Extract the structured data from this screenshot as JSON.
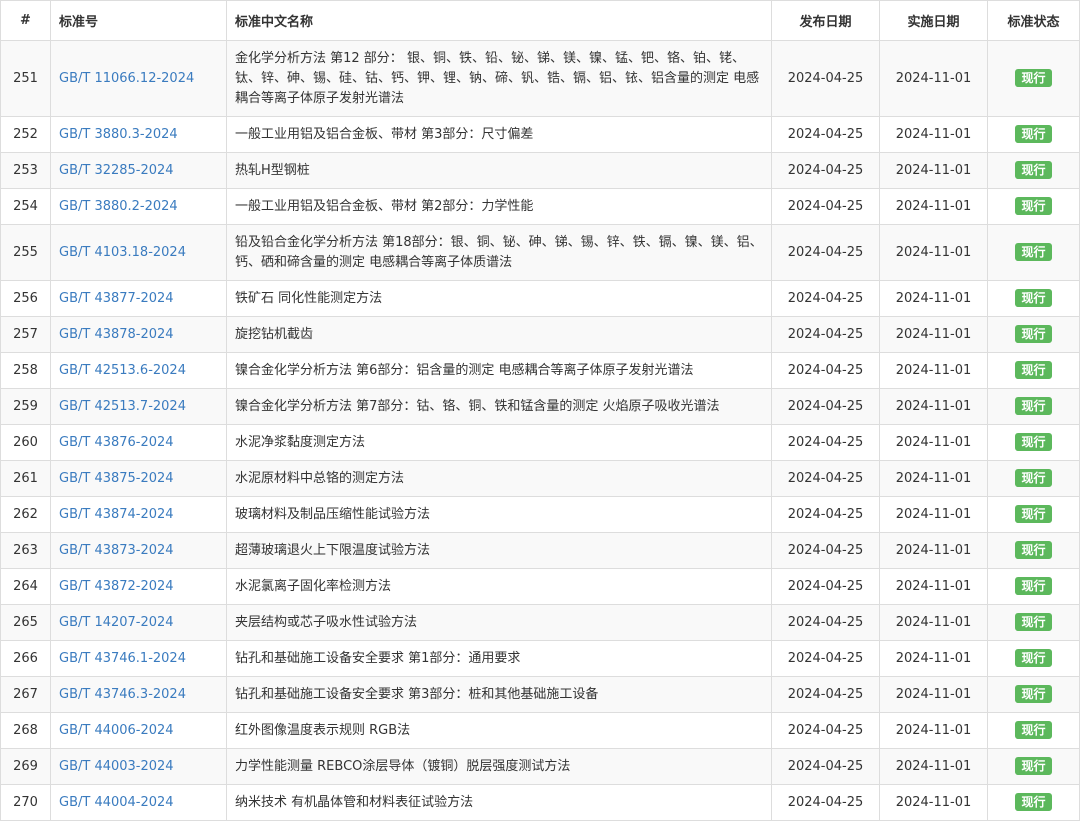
{
  "headers": {
    "num": "#",
    "code": "标准号",
    "name": "标准中文名称",
    "publish": "发布日期",
    "implement": "实施日期",
    "status": "标准状态"
  },
  "rows": [
    {
      "num": "251",
      "code": "GB/T 11066.12-2024",
      "name": "金化学分析方法 第12 部分： 银、铜、铁、铅、铋、锑、镁、镍、锰、钯、铬、铂、铑、钛、锌、砷、锡、硅、钴、钙、钾、锂、钠、碲、钒、锆、镉、铝、铱、铝含量的测定 电感耦合等离子体原子发射光谱法",
      "publish": "2024-04-25",
      "implement": "2024-11-01",
      "status": "现行"
    },
    {
      "num": "252",
      "code": "GB/T 3880.3-2024",
      "name": "一般工业用铝及铝合金板、带材 第3部分：尺寸偏差",
      "publish": "2024-04-25",
      "implement": "2024-11-01",
      "status": "现行"
    },
    {
      "num": "253",
      "code": "GB/T 32285-2024",
      "name": "热轧H型钢桩",
      "publish": "2024-04-25",
      "implement": "2024-11-01",
      "status": "现行"
    },
    {
      "num": "254",
      "code": "GB/T 3880.2-2024",
      "name": "一般工业用铝及铝合金板、带材 第2部分：力学性能",
      "publish": "2024-04-25",
      "implement": "2024-11-01",
      "status": "现行"
    },
    {
      "num": "255",
      "code": "GB/T 4103.18-2024",
      "name": "铅及铅合金化学分析方法 第18部分：银、铜、铋、砷、锑、锡、锌、铁、镉、镍、镁、铝、钙、硒和碲含量的测定 电感耦合等离子体质谱法",
      "publish": "2024-04-25",
      "implement": "2024-11-01",
      "status": "现行"
    },
    {
      "num": "256",
      "code": "GB/T 43877-2024",
      "name": "铁矿石 同化性能测定方法",
      "publish": "2024-04-25",
      "implement": "2024-11-01",
      "status": "现行"
    },
    {
      "num": "257",
      "code": "GB/T 43878-2024",
      "name": "旋挖钻机截齿",
      "publish": "2024-04-25",
      "implement": "2024-11-01",
      "status": "现行"
    },
    {
      "num": "258",
      "code": "GB/T 42513.6-2024",
      "name": "镍合金化学分析方法 第6部分：铝含量的测定 电感耦合等离子体原子发射光谱法",
      "publish": "2024-04-25",
      "implement": "2024-11-01",
      "status": "现行"
    },
    {
      "num": "259",
      "code": "GB/T 42513.7-2024",
      "name": "镍合金化学分析方法 第7部分：钴、铬、铜、铁和锰含量的测定 火焰原子吸收光谱法",
      "publish": "2024-04-25",
      "implement": "2024-11-01",
      "status": "现行"
    },
    {
      "num": "260",
      "code": "GB/T 43876-2024",
      "name": "水泥净浆黏度测定方法",
      "publish": "2024-04-25",
      "implement": "2024-11-01",
      "status": "现行"
    },
    {
      "num": "261",
      "code": "GB/T 43875-2024",
      "name": "水泥原材料中总铬的测定方法",
      "publish": "2024-04-25",
      "implement": "2024-11-01",
      "status": "现行"
    },
    {
      "num": "262",
      "code": "GB/T 43874-2024",
      "name": "玻璃材料及制品压缩性能试验方法",
      "publish": "2024-04-25",
      "implement": "2024-11-01",
      "status": "现行"
    },
    {
      "num": "263",
      "code": "GB/T 43873-2024",
      "name": "超薄玻璃退火上下限温度试验方法",
      "publish": "2024-04-25",
      "implement": "2024-11-01",
      "status": "现行"
    },
    {
      "num": "264",
      "code": "GB/T 43872-2024",
      "name": "水泥氯离子固化率检测方法",
      "publish": "2024-04-25",
      "implement": "2024-11-01",
      "status": "现行"
    },
    {
      "num": "265",
      "code": "GB/T 14207-2024",
      "name": "夹层结构或芯子吸水性试验方法",
      "publish": "2024-04-25",
      "implement": "2024-11-01",
      "status": "现行"
    },
    {
      "num": "266",
      "code": "GB/T 43746.1-2024",
      "name": "钻孔和基础施工设备安全要求 第1部分：通用要求",
      "publish": "2024-04-25",
      "implement": "2024-11-01",
      "status": "现行"
    },
    {
      "num": "267",
      "code": "GB/T 43746.3-2024",
      "name": "钻孔和基础施工设备安全要求 第3部分：桩和其他基础施工设备",
      "publish": "2024-04-25",
      "implement": "2024-11-01",
      "status": "现行"
    },
    {
      "num": "268",
      "code": "GB/T 44006-2024",
      "name": "红外图像温度表示规则 RGB法",
      "publish": "2024-04-25",
      "implement": "2024-11-01",
      "status": "现行"
    },
    {
      "num": "269",
      "code": "GB/T 44003-2024",
      "name": "力学性能测量 REBCO涂层导体（镀铜）脱层强度测试方法",
      "publish": "2024-04-25",
      "implement": "2024-11-01",
      "status": "现行"
    },
    {
      "num": "270",
      "code": "GB/T 44004-2024",
      "name": "纳米技术 有机晶体管和材料表征试验方法",
      "publish": "2024-04-25",
      "implement": "2024-11-01",
      "status": "现行"
    }
  ],
  "colors": {
    "link": "#3a7bbf",
    "badge": "#5cb85c",
    "border": "#dddddd",
    "stripe": "#f9f9f9"
  }
}
